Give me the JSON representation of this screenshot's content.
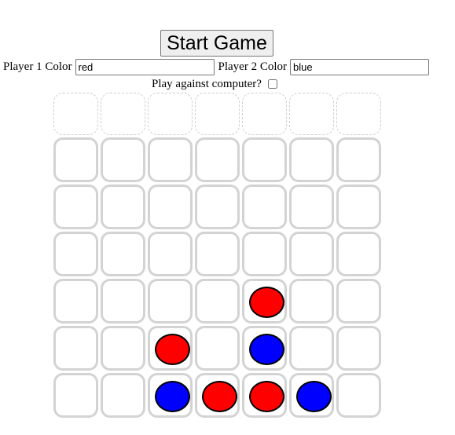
{
  "controls": {
    "start_label": "Start Game",
    "p1_label": "Player 1 Color",
    "p1_value": "red",
    "p2_label": "Player 2 Color",
    "p2_value": "blue",
    "computer_label": "Play against computer?",
    "computer_checked": false
  },
  "colors": {
    "red": "#ff0000",
    "blue": "#0000ff",
    "cell_border": "#d3d3d3"
  },
  "board": {
    "columns": 7,
    "rows": 6,
    "cells": [
      [
        "",
        "",
        "",
        "",
        "",
        "",
        ""
      ],
      [
        "",
        "",
        "",
        "",
        "",
        "",
        ""
      ],
      [
        "",
        "",
        "",
        "",
        "",
        "",
        ""
      ],
      [
        "",
        "",
        "",
        "",
        "red",
        "",
        ""
      ],
      [
        "",
        "",
        "red",
        "",
        "blue",
        "",
        ""
      ],
      [
        "",
        "",
        "blue",
        "red",
        "red",
        "blue",
        ""
      ]
    ]
  }
}
